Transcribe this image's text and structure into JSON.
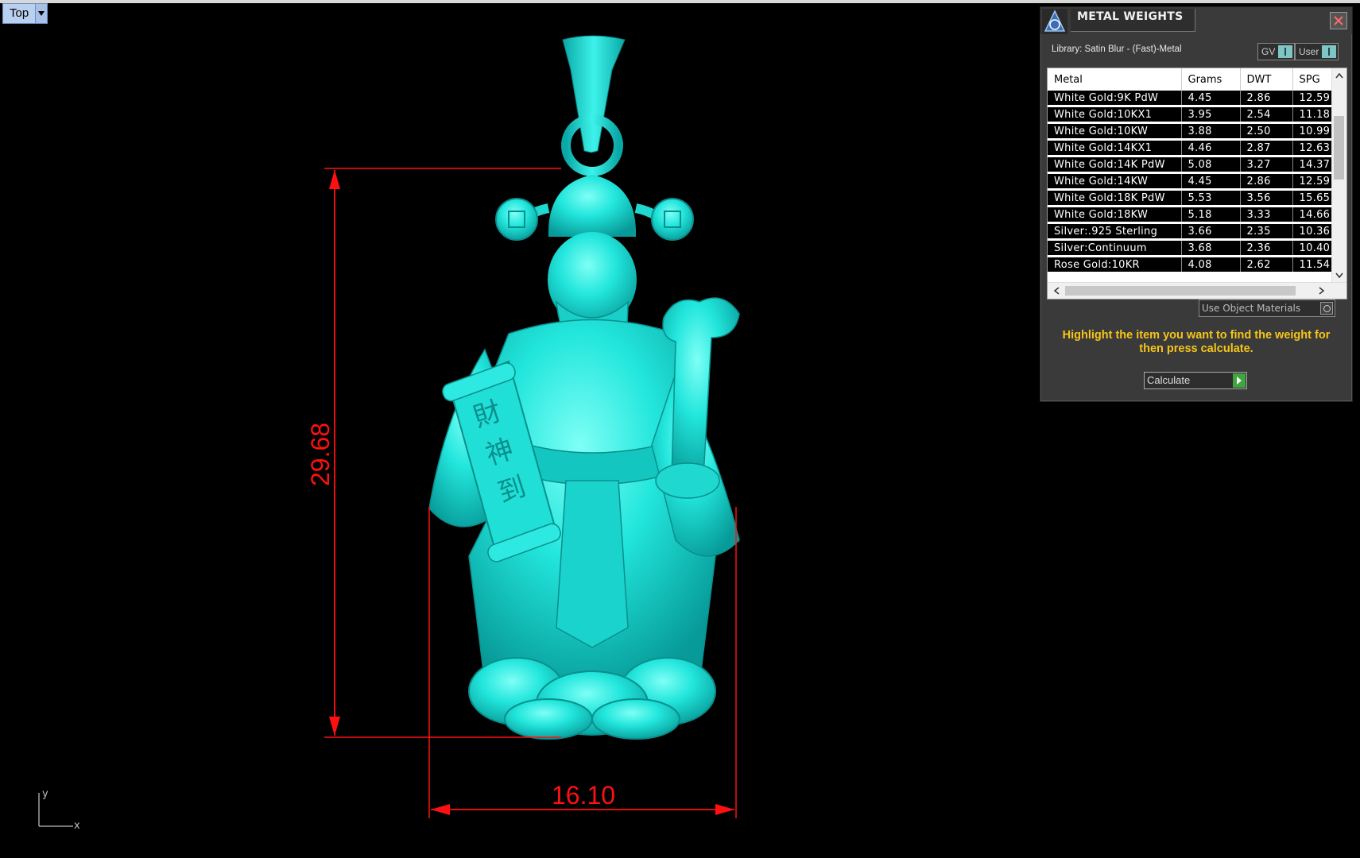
{
  "viewport": {
    "view_name": "Top",
    "axis": {
      "y_label": "y",
      "x_label": "x"
    },
    "dimensions": {
      "height_value": "29.68",
      "width_value": "16.10",
      "color": "#ff1010"
    },
    "model_color": "#18e0d8",
    "scroll_glyphs": [
      "財",
      "神",
      "到"
    ]
  },
  "metal_weights": {
    "title": "METAL WEIGHTS",
    "library": "Library: Satin Blur - (Fast)-Metal",
    "toggles": {
      "gv": "GV",
      "user": "User"
    },
    "columns": [
      "Metal",
      "Grams",
      "DWT",
      "SPG"
    ],
    "rows": [
      [
        "White Gold:9K PdW",
        "4.45",
        "2.86",
        "12.59"
      ],
      [
        "White Gold:10KX1",
        "3.95",
        "2.54",
        "11.18"
      ],
      [
        "White Gold:10KW",
        "3.88",
        "2.50",
        "10.99"
      ],
      [
        "White Gold:14KX1",
        "4.46",
        "2.87",
        "12.63"
      ],
      [
        "White Gold:14K PdW",
        "5.08",
        "3.27",
        "14.37"
      ],
      [
        "White Gold:14KW",
        "4.45",
        "2.86",
        "12.59"
      ],
      [
        "White Gold:18K PdW",
        "5.53",
        "3.56",
        "15.65"
      ],
      [
        "White Gold:18KW",
        "5.18",
        "3.33",
        "14.66"
      ],
      [
        "Silver:.925 Sterling",
        "3.66",
        "2.35",
        "10.36"
      ],
      [
        "Silver:Continuum",
        "3.68",
        "2.36",
        "10.40"
      ],
      [
        "Rose Gold:10KR",
        "4.08",
        "2.62",
        "11.54"
      ]
    ],
    "use_object_materials": "Use Object Materials",
    "instructions": "Highlight the item you want to find the weight for then press calculate.",
    "calculate": "Calculate",
    "accent_color": "#f5c518"
  }
}
